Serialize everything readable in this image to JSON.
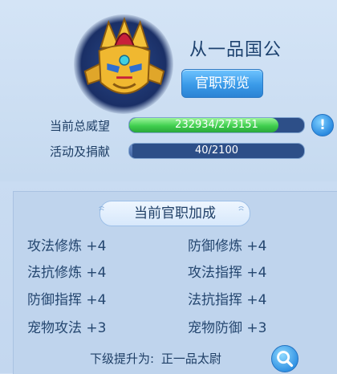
{
  "rank": {
    "title": "从一品国公",
    "preview_button": "官职预览"
  },
  "stats": {
    "prestige_label": "当前总威望",
    "prestige_value": "232934/273151",
    "prestige_fraction": 0.853,
    "donation_label": "活动及捐献",
    "donation_value": "40/2100",
    "donation_fraction": 0.019,
    "info_symbol": "!"
  },
  "bonuses": {
    "header": "当前官职加成",
    "items": [
      {
        "name": "攻法修炼",
        "value": "+4"
      },
      {
        "name": "防御修炼",
        "value": "+4"
      },
      {
        "name": "法抗修炼",
        "value": "+4"
      },
      {
        "name": "攻法指挥",
        "value": "+4"
      },
      {
        "name": "防御指挥",
        "value": "+4"
      },
      {
        "name": "法抗指挥",
        "value": "+4"
      },
      {
        "name": "宠物攻法",
        "value": "+3"
      },
      {
        "name": "宠物防御",
        "value": "+3"
      }
    ]
  },
  "footer": {
    "next_label": "下级提升为:",
    "next_rank": "正一品太尉"
  },
  "icons": {
    "emblem": "golden-helmet-emblem-icon",
    "info": "info-icon",
    "search": "search-icon"
  },
  "colors": {
    "progress_green": "#3fce4e",
    "button_blue": "#3a9ae8"
  }
}
